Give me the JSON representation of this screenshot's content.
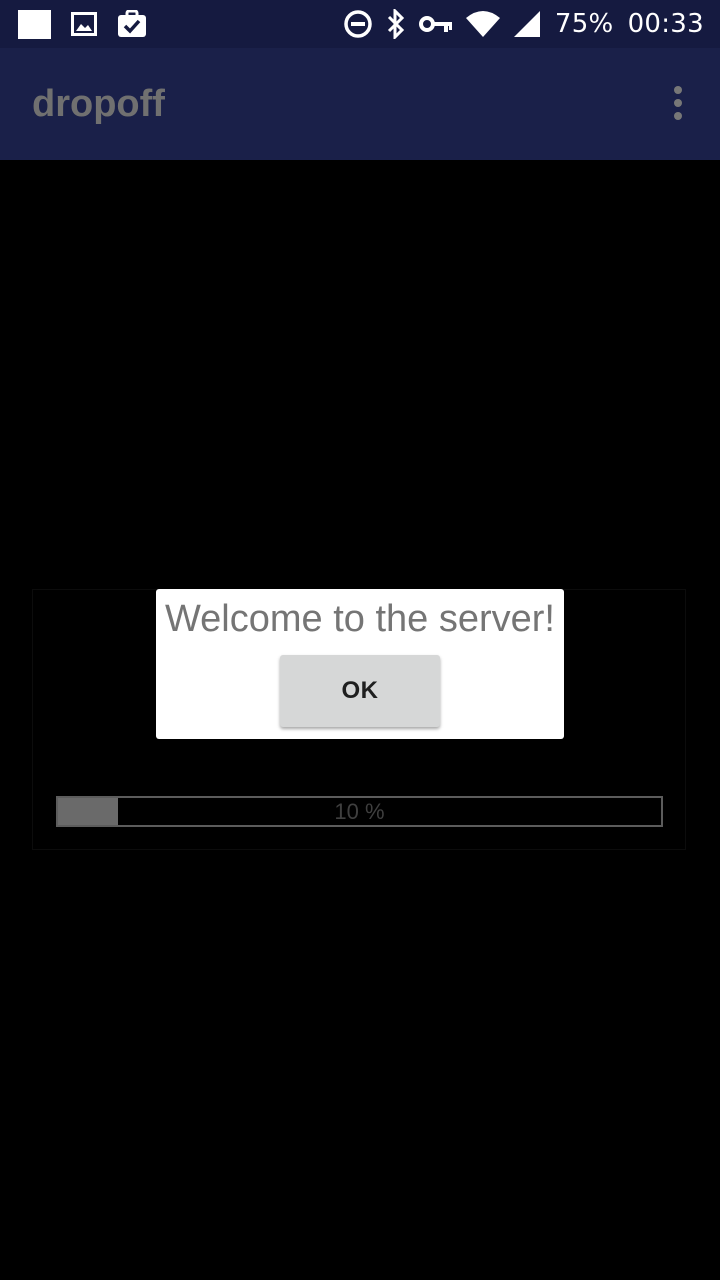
{
  "status_bar": {
    "battery_percent": "75%",
    "time": "00:33",
    "left_icons": [
      "notification-square-icon",
      "image-icon",
      "clipboard-check-icon"
    ],
    "right_icons": [
      "do-not-disturb-icon",
      "bluetooth-icon",
      "vpn-key-icon",
      "wifi-icon",
      "cell-signal-icon"
    ]
  },
  "app_bar": {
    "title": "dropoff",
    "menu_icon": "overflow-menu-icon"
  },
  "progress": {
    "value": 0.1,
    "label": "10 %"
  },
  "dialog": {
    "message": "Welcome to the server!",
    "ok_label": "OK"
  },
  "colors": {
    "status_bar_bg": "#151a40",
    "app_bar_bg": "#1a2049",
    "background": "#000000",
    "dialog_bg": "#ffffff",
    "button_bg": "#d6d7d7"
  }
}
